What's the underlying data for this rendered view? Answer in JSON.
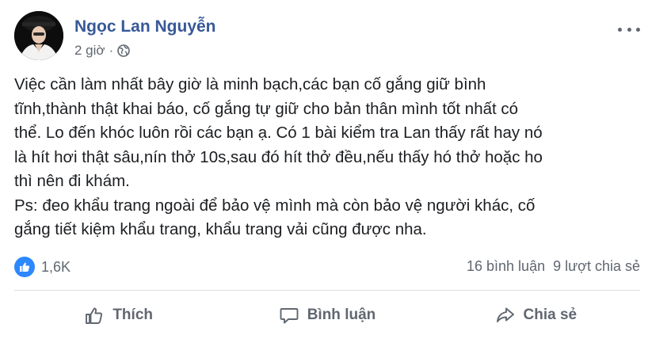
{
  "post": {
    "author": "Ngọc Lan Nguyễn",
    "time": "2 giờ",
    "separator": "·",
    "privacy_icon": "globe-icon",
    "more_icon": "more-icon",
    "body_lines": [
      "Việc cần làm nhất bây giờ là minh bạch,các bạn cố gắng giữ bình",
      "tĩnh,thành thật khai báo, cố gắng tự giữ cho bản thân mình tốt nhất có",
      "thể. Lo đến khóc luôn rồi các bạn ạ. Có 1 bài kiểm tra Lan thấy rất hay nó",
      "là hít hơi thật sâu,nín thở 10s,sau đó hít thở đều,nếu thấy hó thở hoặc ho",
      "thì nên đi khám.",
      "Ps: đeo khẩu trang ngoài để bảo vệ mình mà còn bảo vệ người khác, cố",
      "gắng tiết kiệm khẩu trang, khẩu trang vải cũng được nha."
    ]
  },
  "stats": {
    "reaction_icon": "like-icon",
    "reaction_count": "1,6K",
    "comments": "16 bình luận",
    "shares": "9 lượt chia sẻ"
  },
  "actions": {
    "like_label": "Thích",
    "comment_label": "Bình luận",
    "share_label": "Chia sẻ"
  },
  "colors": {
    "author": "#385898",
    "secondary_text": "#606770",
    "like_badge": "#2d88ff",
    "divider": "#dadde1"
  }
}
